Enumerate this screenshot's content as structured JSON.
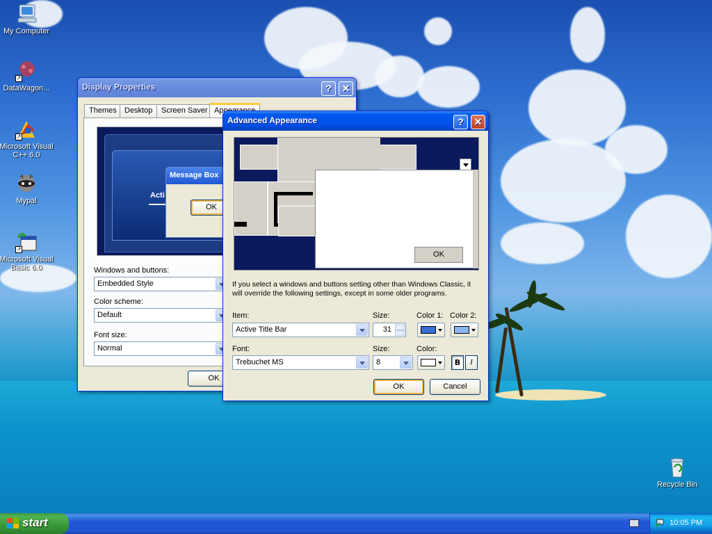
{
  "desktop": {
    "icons": [
      {
        "label": "My Computer",
        "icon": "my-computer-icon"
      },
      {
        "label": "DataWagon...",
        "icon": "datawagon-icon"
      },
      {
        "label": "Microsoft Visual C++ 6.0",
        "icon": "visual-cpp-icon"
      },
      {
        "label": "Mypal",
        "icon": "mypal-icon"
      },
      {
        "label": "Microsoft Visual Basic 6.0",
        "icon": "visual-basic-icon"
      },
      {
        "label": "Recycle Bin",
        "icon": "recycle-bin-icon"
      }
    ]
  },
  "display_properties": {
    "title": "Display Properties",
    "help_glyph": "?",
    "close_glyph": "✕",
    "tabs": [
      "Themes",
      "Desktop",
      "Screen Saver",
      "Appearance"
    ],
    "selected_tab": "Appearance",
    "preview": {
      "inactive_title": "Acti",
      "message_box_title": "Message Box",
      "message_box_ok": "OK"
    },
    "windows_and_buttons_label": "Windows and buttons:",
    "windows_and_buttons_value": "Embedded Style",
    "color_scheme_label": "Color scheme:",
    "color_scheme_value": "Default",
    "font_size_label": "Font size:",
    "font_size_value": "Normal",
    "ok_label": "OK"
  },
  "advanced_appearance": {
    "title": "Advanced Appearance",
    "help_glyph": "?",
    "close_glyph": "✕",
    "preview_ok": "OK",
    "info_text": "If you select a windows and buttons setting other than Windows Classic, it will override the following settings, except in some older programs.",
    "item_label": "Item:",
    "item_value": "Active Title Bar",
    "item_size_label": "Size:",
    "item_size_value": "31",
    "color1_label": "Color 1:",
    "color2_label": "Color 2:",
    "color1": "#3a6fd8",
    "color2": "#8cb4f0",
    "font_label": "Font:",
    "font_value": "Trebuchet MS",
    "font_size_label": "Size:",
    "font_size_value": "8",
    "font_color_label": "Color:",
    "font_color": "#ffffff",
    "bold_label": "B",
    "italic_label": "I",
    "ok_label": "OK",
    "cancel_label": "Cancel"
  },
  "taskbar": {
    "start_label": "start",
    "clock": "10:05 PM"
  },
  "colors": {
    "title_active": "#0058ee",
    "title_inactive": "#6a8ee0",
    "preview_bg": "#0a1a5c",
    "start_green": "#3c9a3c"
  }
}
